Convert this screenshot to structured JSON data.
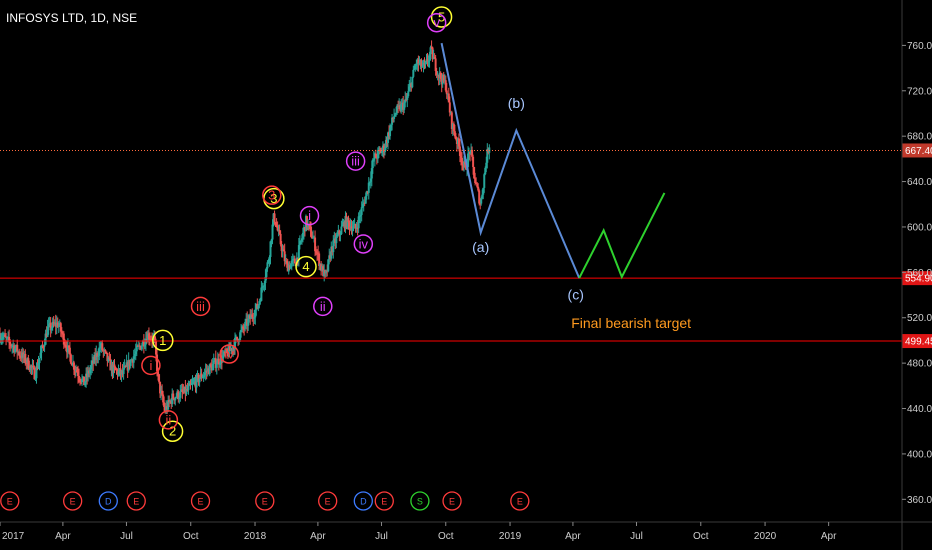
{
  "header": {
    "symbol": "INFOSYS LTD, 1D, NSE"
  },
  "colors": {
    "background": "#000000",
    "up": "#26a69a",
    "down": "#ef5350",
    "hline": "#ff0000",
    "dotted": "#ff6a3d",
    "projection_blue": "#5b8ad6",
    "projection_green": "#2ed12e",
    "wave_yellow": "#ffff33",
    "wave_red": "#ff3b3b",
    "wave_magenta": "#e040fb"
  },
  "chart_data": {
    "type": "candlestick",
    "x_range": [
      "2017-01-01",
      "2020-07-15"
    ],
    "y_range": [
      340,
      800
    ],
    "x_ticks": [
      {
        "date": "2017-01-01",
        "label": "2017"
      },
      {
        "date": "2017-04-01",
        "label": "Apr"
      },
      {
        "date": "2017-07-01",
        "label": "Jul"
      },
      {
        "date": "2017-10-01",
        "label": "Oct"
      },
      {
        "date": "2018-01-01",
        "label": "2018"
      },
      {
        "date": "2018-04-01",
        "label": "Apr"
      },
      {
        "date": "2018-07-01",
        "label": "Jul"
      },
      {
        "date": "2018-10-01",
        "label": "Oct"
      },
      {
        "date": "2019-01-01",
        "label": "2019"
      },
      {
        "date": "2019-04-01",
        "label": "Apr"
      },
      {
        "date": "2019-07-01",
        "label": "Jul"
      },
      {
        "date": "2019-10-01",
        "label": "Oct"
      },
      {
        "date": "2020-01-01",
        "label": "2020"
      },
      {
        "date": "2020-04-01",
        "label": "Apr"
      }
    ],
    "y_ticks": [
      {
        "value": 760,
        "label": "760.00"
      },
      {
        "value": 720,
        "label": "720.00"
      },
      {
        "value": 680,
        "label": "680.00"
      },
      {
        "value": 640,
        "label": "640.00"
      },
      {
        "value": 600,
        "label": "600.00"
      },
      {
        "value": 560,
        "label": "560.00"
      },
      {
        "value": 520,
        "label": "520.00"
      },
      {
        "value": 480,
        "label": "480.00"
      },
      {
        "value": 440,
        "label": "440.00"
      },
      {
        "value": 400,
        "label": "400.00"
      },
      {
        "value": 360,
        "label": "360.00"
      }
    ],
    "price_path": [
      [
        "2017-01-01",
        505
      ],
      [
        "2017-01-20",
        495
      ],
      [
        "2017-02-10",
        480
      ],
      [
        "2017-02-20",
        470
      ],
      [
        "2017-03-10",
        510
      ],
      [
        "2017-03-25",
        515
      ],
      [
        "2017-04-15",
        480
      ],
      [
        "2017-05-01",
        462
      ],
      [
        "2017-05-25",
        495
      ],
      [
        "2017-06-10",
        475
      ],
      [
        "2017-06-25",
        470
      ],
      [
        "2017-07-15",
        490
      ],
      [
        "2017-08-01",
        505
      ],
      [
        "2017-08-10",
        500
      ],
      [
        "2017-08-16",
        462
      ],
      [
        "2017-08-25",
        438
      ],
      [
        "2017-09-05",
        450
      ],
      [
        "2017-09-25",
        455
      ],
      [
        "2017-10-15",
        468
      ],
      [
        "2017-11-05",
        480
      ],
      [
        "2017-11-25",
        490
      ],
      [
        "2017-12-15",
        510
      ],
      [
        "2018-01-05",
        530
      ],
      [
        "2018-01-20",
        570
      ],
      [
        "2018-01-28",
        610
      ],
      [
        "2018-02-05",
        590
      ],
      [
        "2018-02-15",
        565
      ],
      [
        "2018-03-01",
        570
      ],
      [
        "2018-03-15",
        605
      ],
      [
        "2018-03-25",
        590
      ],
      [
        "2018-04-05",
        565
      ],
      [
        "2018-04-12",
        555
      ],
      [
        "2018-04-20",
        580
      ],
      [
        "2018-05-10",
        605
      ],
      [
        "2018-05-25",
        598
      ],
      [
        "2018-06-10",
        630
      ],
      [
        "2018-06-20",
        660
      ],
      [
        "2018-07-05",
        670
      ],
      [
        "2018-07-20",
        700
      ],
      [
        "2018-08-05",
        710
      ],
      [
        "2018-08-20",
        745
      ],
      [
        "2018-09-01",
        740
      ],
      [
        "2018-09-10",
        755
      ],
      [
        "2018-09-20",
        735
      ],
      [
        "2018-10-01",
        725
      ],
      [
        "2018-10-10",
        690
      ],
      [
        "2018-10-20",
        670
      ],
      [
        "2018-10-28",
        650
      ],
      [
        "2018-11-05",
        668
      ],
      [
        "2018-11-12",
        640
      ],
      [
        "2018-11-20",
        620
      ],
      [
        "2018-11-28",
        660
      ],
      [
        "2018-12-03",
        675
      ]
    ],
    "horizontal_lines": [
      {
        "value": 667.4,
        "label": "667.40",
        "style": "dotted"
      },
      {
        "value": 554.9,
        "label": "554.90",
        "style": "solid"
      },
      {
        "value": 499.45,
        "label": "499.45",
        "style": "solid"
      }
    ],
    "projection": {
      "blue": [
        [
          "2018-09-25",
          762
        ],
        [
          "2018-11-20",
          595
        ],
        [
          "2019-01-10",
          685
        ],
        [
          "2019-04-10",
          555
        ]
      ],
      "green": [
        [
          "2019-04-10",
          555
        ],
        [
          "2019-05-15",
          597
        ],
        [
          "2019-06-10",
          556
        ],
        [
          "2019-08-10",
          630
        ]
      ]
    },
    "wave_labels": [
      {
        "text": "1",
        "date": "2017-08-22",
        "value": 500,
        "color": "yellow"
      },
      {
        "text": "2",
        "date": "2017-09-05",
        "value": 420,
        "color": "yellow"
      },
      {
        "text": "3",
        "date": "2018-01-28",
        "value": 625,
        "color": "yellow"
      },
      {
        "text": "4",
        "date": "2018-03-15",
        "value": 565,
        "color": "yellow"
      },
      {
        "text": "5",
        "date": "2018-09-25",
        "value": 785,
        "color": "yellow"
      },
      {
        "text": "i",
        "date": "2017-08-05",
        "value": 478,
        "color": "red"
      },
      {
        "text": "ii",
        "date": "2017-08-30",
        "value": 430,
        "color": "red"
      },
      {
        "text": "iii",
        "date": "2017-10-15",
        "value": 530,
        "color": "red"
      },
      {
        "text": "iv",
        "date": "2017-11-25",
        "value": 488,
        "color": "red"
      },
      {
        "text": "3",
        "date": "2018-01-25",
        "value": 628,
        "color": "red"
      },
      {
        "text": "i",
        "date": "2018-03-20",
        "value": 610,
        "color": "magenta"
      },
      {
        "text": "ii",
        "date": "2018-04-08",
        "value": 530,
        "color": "magenta"
      },
      {
        "text": "iii",
        "date": "2018-05-25",
        "value": 658,
        "color": "magenta"
      },
      {
        "text": "iv",
        "date": "2018-06-05",
        "value": 585,
        "color": "magenta"
      },
      {
        "text": "v",
        "date": "2018-09-18",
        "value": 780,
        "color": "magenta"
      }
    ],
    "projection_labels": [
      {
        "text": "(b)",
        "date": "2019-01-10",
        "value": 705
      },
      {
        "text": "(a)",
        "date": "2018-11-20",
        "value": 578
      },
      {
        "text": "(c)",
        "date": "2019-04-05",
        "value": 536
      }
    ],
    "annotation": {
      "text": "Final bearish target",
      "date": "2019-04-10",
      "value": 511
    },
    "events": [
      {
        "text": "E",
        "date": "2017-01-15",
        "color": "#ff3b3b"
      },
      {
        "text": "E",
        "date": "2017-04-15",
        "color": "#ff3b3b"
      },
      {
        "text": "D",
        "date": "2017-06-05",
        "color": "#3d7bff"
      },
      {
        "text": "E",
        "date": "2017-07-15",
        "color": "#ff3b3b"
      },
      {
        "text": "E",
        "date": "2017-10-15",
        "color": "#ff3b3b"
      },
      {
        "text": "E",
        "date": "2018-01-15",
        "color": "#ff3b3b"
      },
      {
        "text": "E",
        "date": "2018-04-15",
        "color": "#ff3b3b"
      },
      {
        "text": "D",
        "date": "2018-06-05",
        "color": "#3d7bff"
      },
      {
        "text": "E",
        "date": "2018-07-05",
        "color": "#ff3b3b"
      },
      {
        "text": "S",
        "date": "2018-08-25",
        "color": "#2ed12e"
      },
      {
        "text": "E",
        "date": "2018-10-10",
        "color": "#ff3b3b"
      },
      {
        "text": "E",
        "date": "2019-01-15",
        "color": "#ff3b3b"
      }
    ]
  }
}
